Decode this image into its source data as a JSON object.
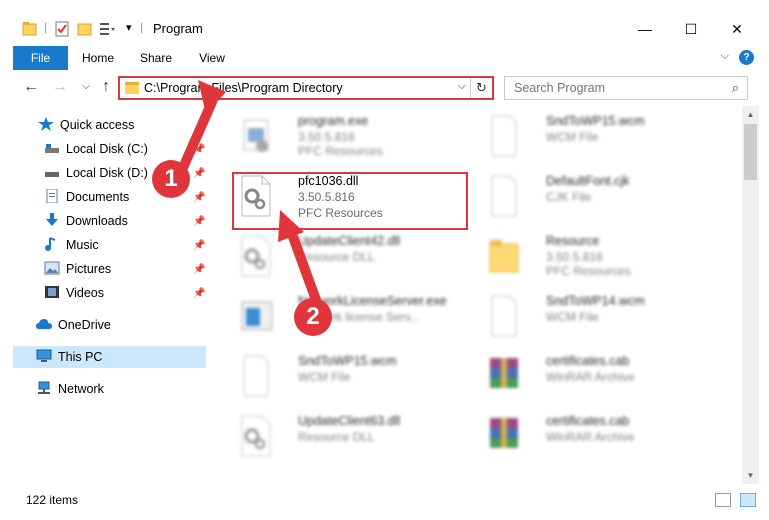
{
  "window": {
    "title": "Program",
    "minimize": "—",
    "maximize": "☐",
    "close": "✕"
  },
  "ribbon": {
    "tabs": [
      "File",
      "Home",
      "Share",
      "View"
    ],
    "help": "?"
  },
  "address_bar": {
    "path": "C:\\Program Files\\Program Directory",
    "dropdown": "⌵",
    "refresh": "↻"
  },
  "search": {
    "placeholder": "Search Program",
    "icon": "⌕"
  },
  "nav": {
    "items": [
      {
        "label": "Quick access",
        "icon": "star-icon",
        "pinned": false
      },
      {
        "label": "Local Disk (C:)",
        "icon": "drive-icon",
        "pinned": true
      },
      {
        "label": "Local Disk (D:)",
        "icon": "drive-icon",
        "pinned": true
      },
      {
        "label": "Documents",
        "icon": "documents-icon",
        "pinned": true
      },
      {
        "label": "Downloads",
        "icon": "download-icon",
        "pinned": true
      },
      {
        "label": "Music",
        "icon": "music-icon",
        "pinned": true
      },
      {
        "label": "Pictures",
        "icon": "pictures-icon",
        "pinned": true
      },
      {
        "label": "Videos",
        "icon": "videos-icon",
        "pinned": true
      },
      {
        "label": "OneDrive",
        "icon": "cloud-icon",
        "pinned": false
      },
      {
        "label": "This PC",
        "icon": "computer-icon",
        "pinned": false,
        "selected": true
      },
      {
        "label": "Network",
        "icon": "network-icon",
        "pinned": false
      }
    ],
    "pin_glyph": "📌"
  },
  "files": [
    {
      "name": "program.exe",
      "line1": "3.50.5.816",
      "line2": "PFC Resources",
      "icon": "exe-icon"
    },
    {
      "name": "SndToWP15.wcm",
      "line1": "WCM File",
      "line2": "",
      "icon": "blank-file-icon"
    },
    {
      "name": "pfc1036.dll",
      "line1": "3.50.5.816",
      "line2": "PFC Resources",
      "icon": "dll-icon"
    },
    {
      "name": "DefaultFont.cjk",
      "line1": "CJK File",
      "line2": "",
      "icon": "blank-file-icon"
    },
    {
      "name": "UpdateClient42.dll",
      "line1": "Resource DLL",
      "line2": "",
      "icon": "dll-icon"
    },
    {
      "name": "Resource",
      "line1": "3.50.5.816",
      "line2": "PFC Resources",
      "icon": "folder-icon"
    },
    {
      "name": "NetworkLicenseServer.exe",
      "line1": "Network license Serv...",
      "line2": "",
      "icon": "window-exe-icon"
    },
    {
      "name": "SndToWP14.wcm",
      "line1": "WCM File",
      "line2": "",
      "icon": "blank-file-icon"
    },
    {
      "name": "SndToWP15.wcm",
      "line1": "WCM File",
      "line2": "",
      "icon": "blank-file-icon"
    },
    {
      "name": "certificates.cab",
      "line1": "WinRAR Archive",
      "line2": "",
      "icon": "winrar-icon"
    },
    {
      "name": "UpdateClient63.dll",
      "line1": "Resource DLL",
      "line2": "",
      "icon": "dll-icon"
    },
    {
      "name": "certificates.cab",
      "line1": "WinRAR Archive",
      "line2": "",
      "icon": "winrar-icon"
    }
  ],
  "status": {
    "count": "122 items"
  },
  "callouts": [
    "1",
    "2"
  ],
  "colors": {
    "accent": "#1979ca",
    "highlight": "#e0353b",
    "selected_nav": "#cce8ff"
  }
}
